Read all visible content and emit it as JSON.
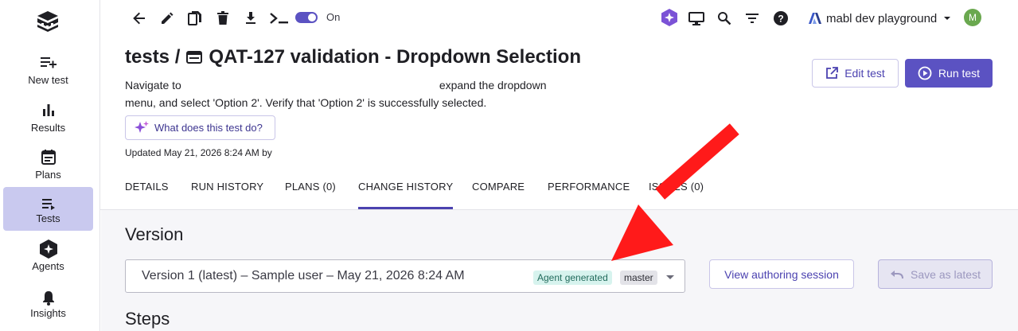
{
  "sidebar": {
    "items": [
      {
        "label": "New test",
        "icon": "new-test-icon"
      },
      {
        "label": "Results",
        "icon": "results-chart-icon"
      },
      {
        "label": "Plans",
        "icon": "calendar-icon"
      },
      {
        "label": "Tests",
        "icon": "tests-list-icon",
        "active": true
      },
      {
        "label": "Agents",
        "icon": "agents-icon"
      },
      {
        "label": "Insights",
        "icon": "bell-icon"
      }
    ]
  },
  "toolbar": {
    "toggle_label": "On",
    "workspace_name": "mabl dev playground",
    "avatar_initial": "M"
  },
  "header": {
    "breadcrumb_root": "tests /",
    "title": "QAT-127 validation - Dropdown Selection",
    "description_start": "Navigate to",
    "description_end": "expand the dropdown",
    "description_line2": "menu, and select 'Option 2'. Verify that 'Option 2' is successfully selected.",
    "ai_button_label": "What does this test do?",
    "updated_text": "Updated May 21, 2026 8:24 AM by",
    "edit_button_label": "Edit test",
    "run_button_label": "Run test"
  },
  "tabs": [
    {
      "label": "DETAILS"
    },
    {
      "label": "RUN HISTORY"
    },
    {
      "label": "PLANS (0)"
    },
    {
      "label": "CHANGE HISTORY",
      "active": true
    },
    {
      "label": "COMPARE"
    },
    {
      "label": "PERFORMANCE"
    },
    {
      "label": "ISSUES (0)"
    }
  ],
  "version": {
    "section_title": "Version",
    "selected_value": "Version 1 (latest) – Sample user – May 21, 2026 8:24 AM",
    "agent_badge": "Agent generated",
    "branch_badge": "master",
    "authoring_button_label": "View authoring session",
    "save_latest_button_label": "Save as latest"
  },
  "steps": {
    "section_title": "Steps"
  },
  "colors": {
    "accent": "#5b52c2",
    "active_nav_bg": "#c9c9ef",
    "annotation_arrow": "#ff1a1a"
  }
}
